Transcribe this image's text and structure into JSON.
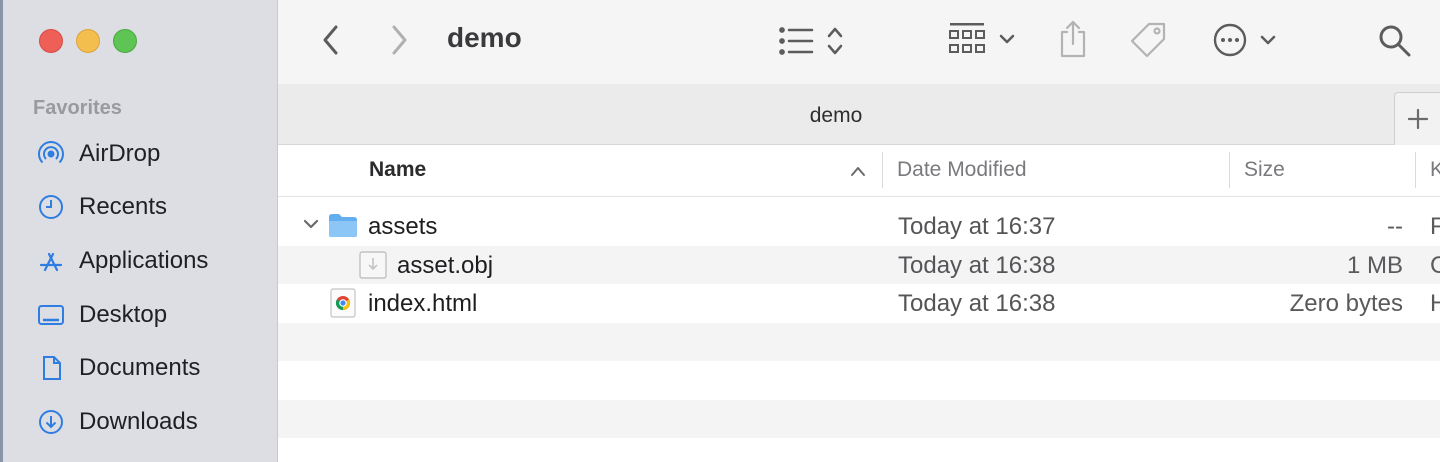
{
  "window": {
    "title": "demo"
  },
  "sidebar": {
    "section_title": "Favorites",
    "items": [
      {
        "label": "AirDrop",
        "icon": "airdrop-icon"
      },
      {
        "label": "Recents",
        "icon": "clock-icon"
      },
      {
        "label": "Applications",
        "icon": "applications-icon"
      },
      {
        "label": "Desktop",
        "icon": "desktop-icon"
      },
      {
        "label": "Documents",
        "icon": "document-icon"
      },
      {
        "label": "Downloads",
        "icon": "download-icon"
      }
    ]
  },
  "tab": {
    "title": "demo",
    "add_label": "+"
  },
  "columns": {
    "name": "Name",
    "date": "Date Modified",
    "size": "Size",
    "kind": "K"
  },
  "files": [
    {
      "name": "assets",
      "date": "Today at 16:37",
      "size": "--",
      "kind": "F",
      "type": "folder",
      "expanded": true
    },
    {
      "name": "asset.obj",
      "date": "Today at 16:38",
      "size": "1 MB",
      "kind": "C",
      "type": "file"
    },
    {
      "name": "index.html",
      "date": "Today at 16:38",
      "size": "Zero bytes",
      "kind": "H",
      "type": "html"
    }
  ],
  "colors": {
    "accent": "#2f7de1",
    "sidebar_bg": "#dcdee3"
  }
}
